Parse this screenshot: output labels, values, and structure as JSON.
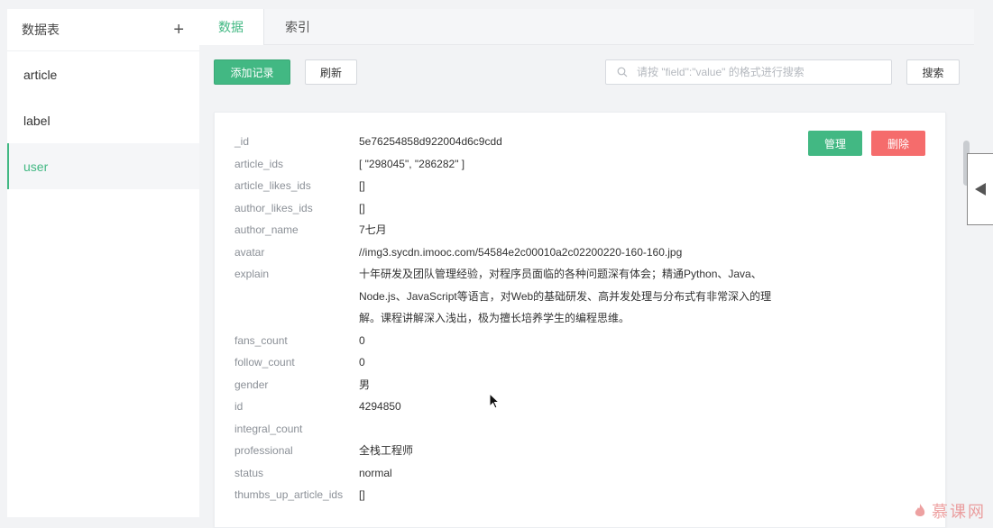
{
  "sidebar": {
    "title": "数据表",
    "items": [
      {
        "label": "article"
      },
      {
        "label": "label"
      },
      {
        "label": "user"
      }
    ]
  },
  "tabs": [
    {
      "label": "数据"
    },
    {
      "label": "索引"
    }
  ],
  "toolbar": {
    "add_label": "添加记录",
    "refresh_label": "刷新",
    "search_placeholder": "请按 \"field\":\"value\" 的格式进行搜索",
    "search_value": "",
    "search_label": "搜索"
  },
  "record": {
    "manage_label": "管理",
    "delete_label": "删除",
    "fields": [
      {
        "key": "_id",
        "value": "5e76254858d922004d6c9cdd"
      },
      {
        "key": "article_ids",
        "value": "[ \"298045\", \"286282\" ]"
      },
      {
        "key": "article_likes_ids",
        "value": "[]"
      },
      {
        "key": "author_likes_ids",
        "value": "[]"
      },
      {
        "key": "author_name",
        "value": "7七月"
      },
      {
        "key": "avatar",
        "value": "//img3.sycdn.imooc.com/54584e2c00010a2c02200220-160-160.jpg"
      },
      {
        "key": "explain",
        "value": "十年研发及团队管理经验，对程序员面临的各种问题深有体会；精通Python、Java、Node.js、JavaScript等语言，对Web的基础研发、高并发处理与分布式有非常深入的理解。课程讲解深入浅出，极为擅长培养学生的编程思维。"
      },
      {
        "key": "fans_count",
        "value": "0"
      },
      {
        "key": "follow_count",
        "value": "0"
      },
      {
        "key": "gender",
        "value": "男"
      },
      {
        "key": "id",
        "value": "4294850"
      },
      {
        "key": "integral_count",
        "value": ""
      },
      {
        "key": "professional",
        "value": "全栈工程师"
      },
      {
        "key": "status",
        "value": "normal"
      },
      {
        "key": "thumbs_up_article_ids",
        "value": "[]"
      }
    ]
  },
  "watermark": "慕课网",
  "colors": {
    "accent": "#42b883",
    "danger": "#f56c6c"
  }
}
